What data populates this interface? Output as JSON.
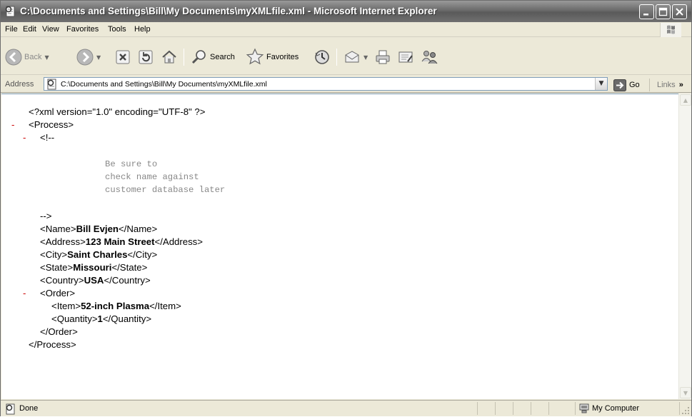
{
  "window": {
    "title": "C:\\Documents and Settings\\Bill\\My Documents\\myXMLfile.xml - Microsoft Internet Explorer"
  },
  "menu": [
    "File",
    "Edit",
    "View",
    "Favorites",
    "Tools",
    "Help"
  ],
  "toolbar": {
    "back": "Back",
    "search": "Search",
    "favorites": "Favorites"
  },
  "address": {
    "label": "Address",
    "url": "C:\\Documents and Settings\\Bill\\My Documents\\myXMLfile.xml",
    "go": "Go",
    "links": "Links"
  },
  "xml": {
    "decl": "<?xml version=\"1.0\" encoding=\"UTF-8\" ?>",
    "process_open": "<Process>",
    "comment_open": "<!--",
    "comment_lines": [
      "Be sure to",
      "check name against",
      "customer database later"
    ],
    "comment_close": "-->",
    "name_open": "<Name>",
    "name_val": "Bill Evjen",
    "name_close": "</Name>",
    "address_open": "<Address>",
    "address_val": "123 Main Street",
    "address_close": "</Address>",
    "city_open": "<City>",
    "city_val": "Saint Charles",
    "city_close": "</City>",
    "state_open": "<State>",
    "state_val": "Missouri",
    "state_close": "</State>",
    "country_open": "<Country>",
    "country_val": "USA",
    "country_close": "</Country>",
    "order_open": "<Order>",
    "item_open": "<Item>",
    "item_val": "52-inch Plasma",
    "item_close": "</Item>",
    "qty_open": "<Quantity>",
    "qty_val": "1",
    "qty_close": "</Quantity>",
    "order_close": "</Order>",
    "process_close": "</Process>",
    "collapse_marker": "-"
  },
  "status": {
    "text": "Done",
    "zone": "My Computer"
  },
  "colors": {
    "marker": "#cc0000",
    "comment": "#888888",
    "titlebar": "#6a6a6a"
  }
}
